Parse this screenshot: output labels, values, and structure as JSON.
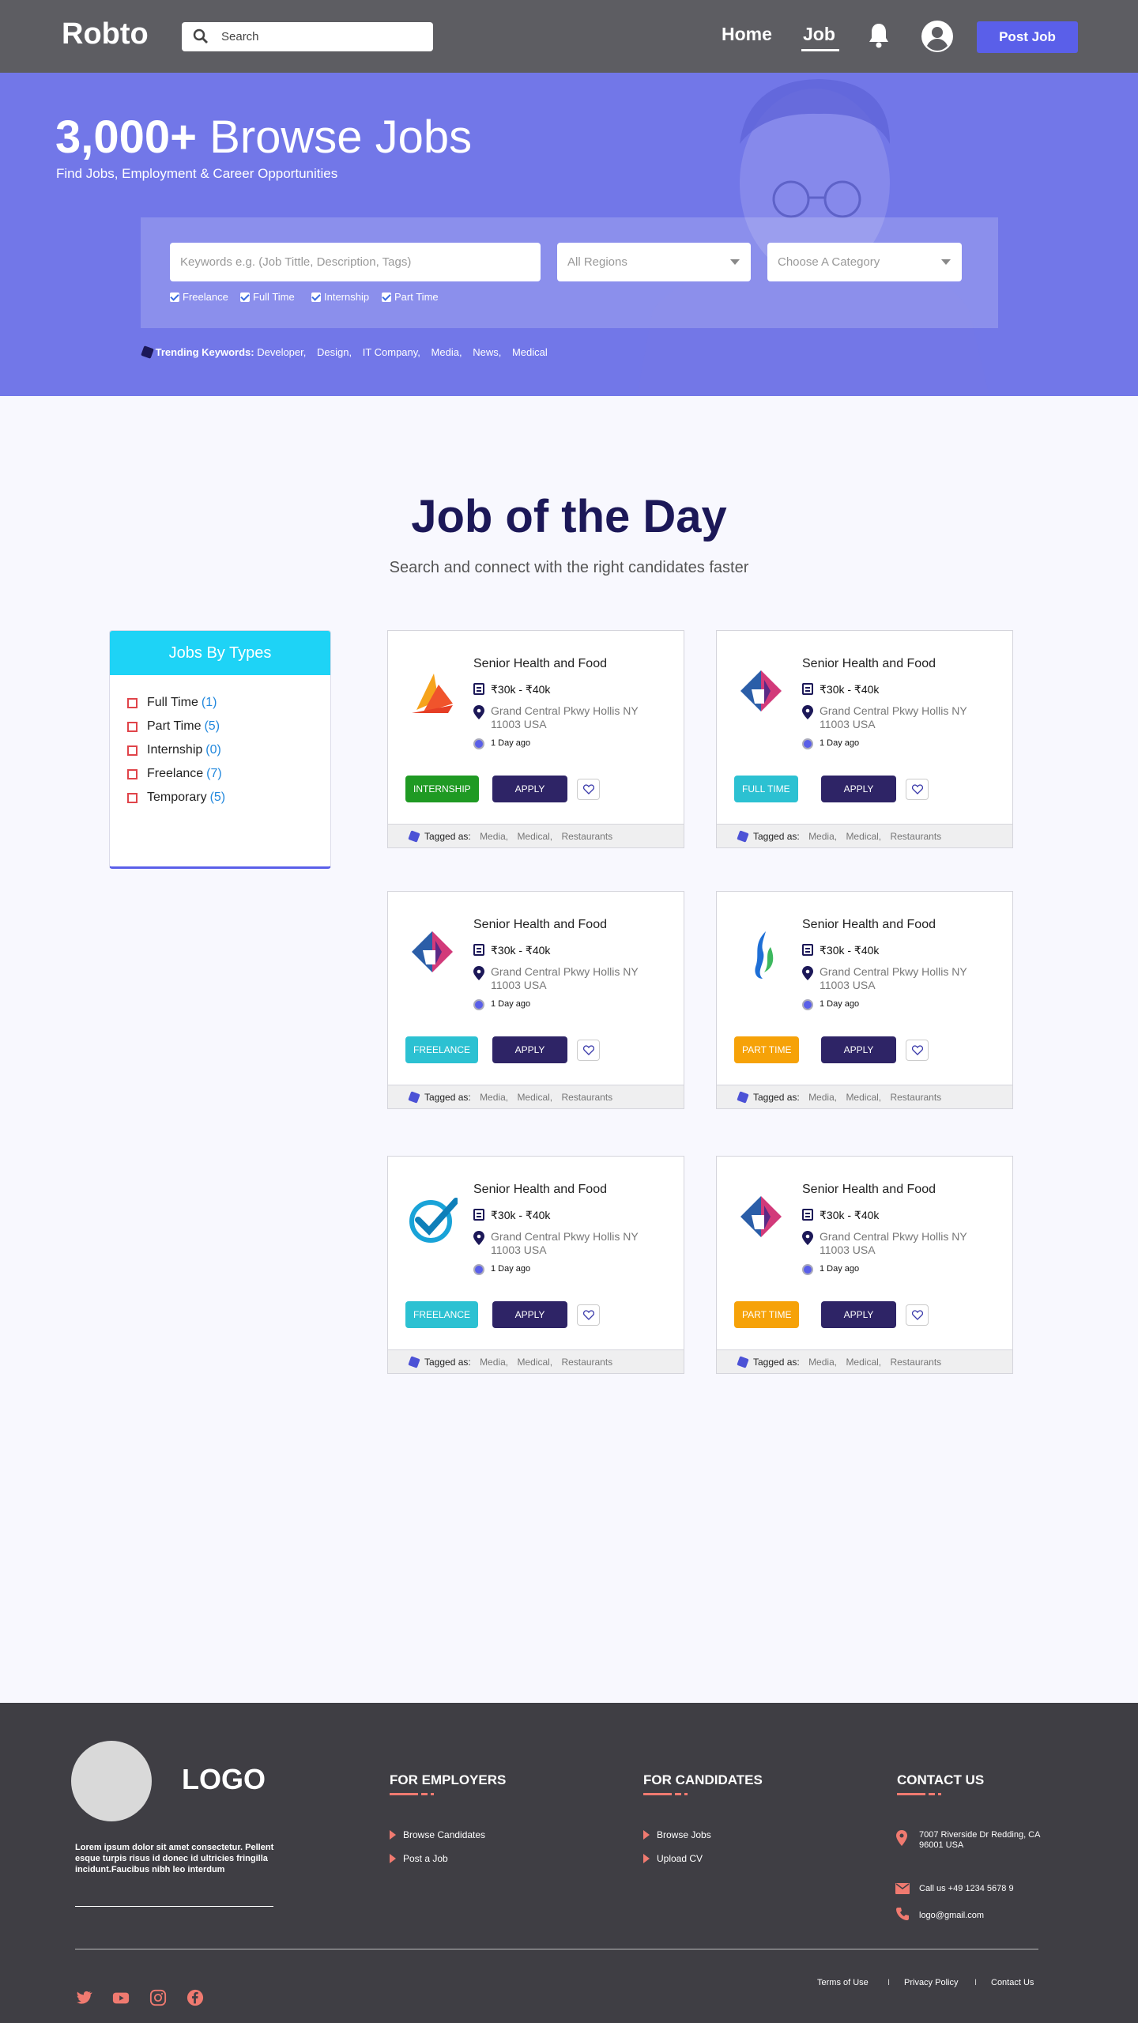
{
  "header": {
    "logo": "Robto",
    "search_placeholder": "Search",
    "nav": [
      {
        "label": "Home"
      },
      {
        "label": "Job"
      }
    ],
    "post_job": "Post Job"
  },
  "hero": {
    "count": "3,000+",
    "title_rest": "Browse Jobs",
    "subtitle": "Find Jobs, Employment & Career Opportunities",
    "keyword_placeholder": "Keywords e.g. (Job Tittle, Description, Tags)",
    "region_select": "All Regions",
    "category_select": "Choose A Category",
    "checkboxes": [
      "Freelance",
      "Full Time",
      "Internship",
      "Part Time"
    ],
    "trending_label": "Trending Keywords:",
    "trending": [
      "Developer,",
      "Design,",
      "IT Company,",
      "Media,",
      "News,",
      "Medical"
    ]
  },
  "section": {
    "title": "Job of the Day",
    "subtitle": "Search and connect with the right candidates faster"
  },
  "types": {
    "heading": "Jobs By Types",
    "items": [
      {
        "label": "Full Time",
        "count": "(1)"
      },
      {
        "label": "Part Time",
        "count": "(5)"
      },
      {
        "label": "Internship",
        "count": "(0)"
      },
      {
        "label": "Freelance",
        "count": "(7)"
      },
      {
        "label": "Temporary",
        "count": "(5)"
      }
    ]
  },
  "jobs": [
    {
      "title": "Senior Health and Food",
      "salary": "₹30k - ₹40k",
      "address": "Grand Central Pkwy Hollis NY 11003 USA",
      "posted": "1 Day ago",
      "type": "INTERNSHIP",
      "type_color": "#1f9a23",
      "apply": "APPLY",
      "tagged": "Tagged as:",
      "tags": [
        "Media,",
        "Medical,",
        "Restaurants"
      ],
      "logo": "orange-sail-icon"
    },
    {
      "title": "Senior Health and Food",
      "salary": "₹30k - ₹40k",
      "address": "Grand Central Pkwy Hollis NY 11003 USA",
      "posted": "1 Day ago",
      "type": "FULL TIME",
      "type_color": "#2cc1d2",
      "apply": "APPLY",
      "tagged": "Tagged as:",
      "tags": [
        "Media,",
        "Medical,",
        "Restaurants"
      ],
      "logo": "diamond-fold-icon"
    },
    {
      "title": "Senior Health and Food",
      "salary": "₹30k - ₹40k",
      "address": "Grand Central Pkwy Hollis NY 11003 USA",
      "posted": "1 Day ago",
      "type": "FREELANCE",
      "type_color": "#2cc1d2",
      "apply": "APPLY",
      "tagged": "Tagged as:",
      "tags": [
        "Media,",
        "Medical,",
        "Restaurants"
      ],
      "logo": "diamond-fold-icon"
    },
    {
      "title": "Senior Health and Food",
      "salary": "₹30k - ₹40k",
      "address": "Grand Central Pkwy Hollis NY 11003 USA",
      "posted": "1 Day ago",
      "type": "PART TIME",
      "type_color": "#f6a208",
      "apply": "APPLY",
      "tagged": "Tagged as:",
      "tags": [
        "Media,",
        "Medical,",
        "Restaurants"
      ],
      "logo": "flame-icon"
    },
    {
      "title": "Senior Health and Food",
      "salary": "₹30k - ₹40k",
      "address": "Grand Central Pkwy Hollis NY 11003 USA",
      "posted": "1 Day ago",
      "type": "FREELANCE",
      "type_color": "#2cc1d2",
      "apply": "APPLY",
      "tagged": "Tagged as:",
      "tags": [
        "Media,",
        "Medical,",
        "Restaurants"
      ],
      "logo": "check-swirl-icon"
    },
    {
      "title": "Senior Health and Food",
      "salary": "₹30k - ₹40k",
      "address": "Grand Central Pkwy Hollis NY 11003 USA",
      "posted": "1 Day ago",
      "type": "PART TIME",
      "type_color": "#f6a208",
      "apply": "APPLY",
      "tagged": "Tagged as:",
      "tags": [
        "Media,",
        "Medical,",
        "Restaurants"
      ],
      "logo": "diamond-fold-icon"
    }
  ],
  "footer": {
    "logo": "LOGO",
    "description": "Lorem ipsum dolor sit amet consectetur. Pellent esque turpis risus id donec id ultricies fringilla incidunt.Faucibus nibh leo interdum",
    "employers": {
      "heading": "FOR EMPLOYERS",
      "links": [
        "Browse Candidates",
        "Post a Job"
      ]
    },
    "candidates": {
      "heading": "FOR CANDIDATES",
      "links": [
        "Browse Jobs",
        "Upload CV"
      ]
    },
    "contact": {
      "heading": "CONTACT US",
      "address": "7007 Riverside Dr Redding, CA 96001 USA",
      "phone": "Call us +49 1234 5678 9",
      "email": "logo@gmail.com"
    },
    "legal": [
      "Terms of Use",
      "Privacy Policy",
      "Contact Us"
    ],
    "separator": "I",
    "social": [
      "twitter-icon",
      "youtube-icon",
      "instagram-icon",
      "facebook-icon"
    ],
    "accent": "#f07a70"
  }
}
